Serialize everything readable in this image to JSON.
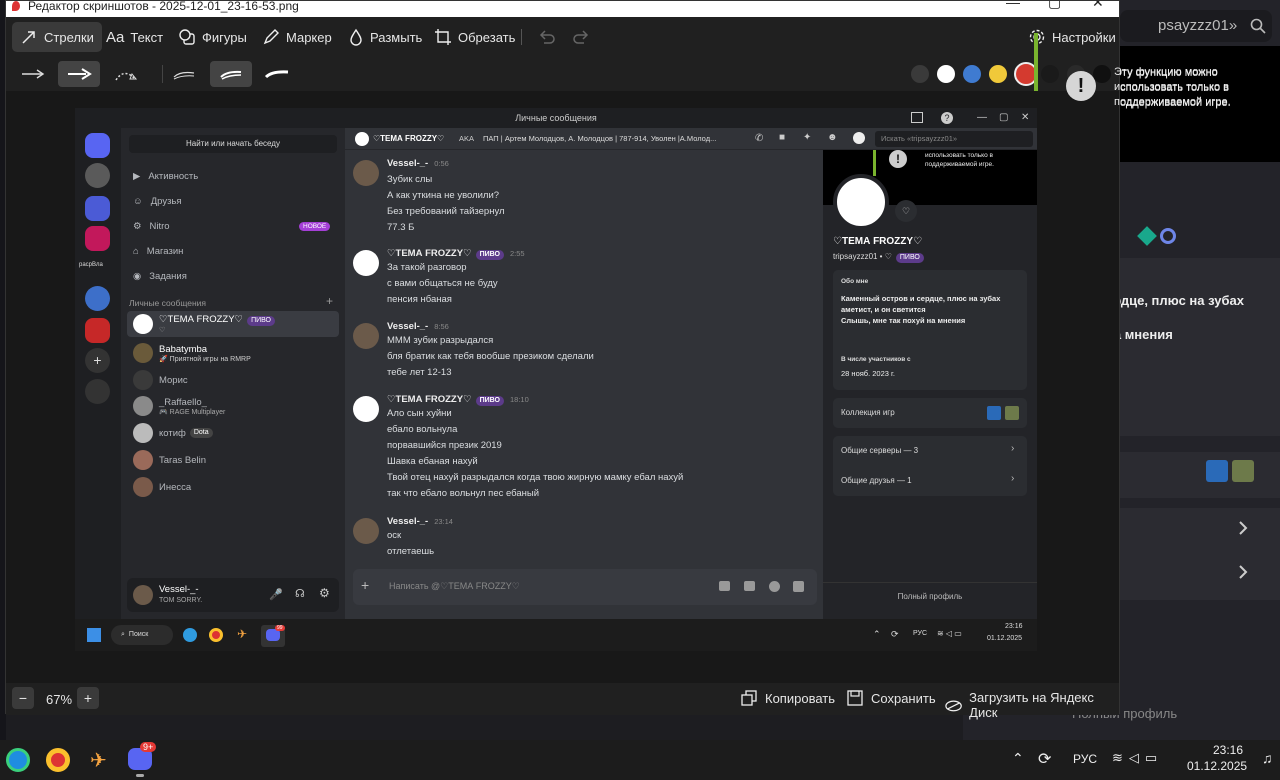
{
  "bg": {
    "search_text": "psayzzz01»",
    "feature_note": "Эту функцию можно использовать только в поддерживаемой игре.",
    "about_l1": "ердце, плюс на зубах",
    "about_l2": "я",
    "about_l3": "на мнения",
    "full_profile": "Полный профиль"
  },
  "editor": {
    "title": "Редактор скриншотов - 2025-12-01_23-16-53.png",
    "tools": {
      "arrows": "Стрелки",
      "text": "Текст",
      "figures": "Фигуры",
      "marker": "Маркер",
      "blur": "Размыть",
      "crop": "Обрезать",
      "settings": "Настройки"
    },
    "colors": [
      "#3a3a3a",
      "#ffffff",
      "#3f7bd1",
      "#f0c93a",
      "#d43a2f",
      "#1a1a1a",
      "#2a2a2a",
      "#101010"
    ],
    "zoom": "67%",
    "copy": "Копировать",
    "save": "Сохранить",
    "upload": "Загрузить на Яндекс Диск",
    "note": "Эту функцию можно использовать только в поддерживаемой игре."
  },
  "discord": {
    "window_title": "Личные сообщения",
    "find_button": "Найти или начать беседу",
    "nav": [
      {
        "label": "Активность"
      },
      {
        "label": "Друзья"
      },
      {
        "label": "Nitro",
        "badge": "НОВОЕ"
      },
      {
        "label": "Магазин"
      },
      {
        "label": "Задания"
      }
    ],
    "dm_header": "Личные сообщения",
    "server_label": "pacpВла",
    "dms": [
      {
        "name": "♡ТЕМА FROZZY♡",
        "badge": "ПИВО",
        "sub": "♡"
      },
      {
        "name": "Babatymba",
        "sub": "🚀 Приятной игры на RMRP"
      },
      {
        "name": "Морис",
        "sub": ""
      },
      {
        "name": "_Raffaello_",
        "sub": "🎮 RAGE Multiplayer"
      },
      {
        "name": "котиф",
        "badge2": "Dota",
        "sub": ""
      },
      {
        "name": "Taras Belin",
        "sub": ""
      },
      {
        "name": "Инесса",
        "sub": ""
      }
    ],
    "me": {
      "name": "Vessel-_-",
      "status": "TOM SORRY."
    },
    "chat_header": {
      "name": "♡ТЕМА FROZZY♡",
      "aka_label": "AKA",
      "aka": "ПАП | Артем Молодцов, А. Молодцов | 787-914, Уволен |А.Молод...",
      "search": "Искать «tripsayzzz01»"
    },
    "messages": [
      {
        "author": "Vessel-_-",
        "time": "0:56",
        "lines": [
          "Зубик слы",
          "А как уткина не уволили?",
          "Без требований тайзернул",
          "77.3 Б"
        ]
      },
      {
        "author": "♡ТЕМА FROZZY♡",
        "badge": "ПИВО",
        "time": "2:55",
        "lines": [
          "За такой разговор",
          "с вами общаться не буду",
          "пенсия нбаная"
        ]
      },
      {
        "author": "Vessel-_-",
        "time": "8:56",
        "lines": [
          "МММ зубик разрыдался",
          "бля братик как тебя вообше презиком сделали",
          "тебе лет 12-13"
        ]
      },
      {
        "author": "♡ТЕМА FROZZY♡",
        "badge": "ПИВО",
        "time": "18:10",
        "lines": [
          "Ало сын хуйни",
          "ебало вольнула",
          "порвавшийся презик 2019",
          "Шавка ебаная нахуй",
          "Твой отец нахуй разрыдался когда твою жирную мамку ебал нахуй",
          "так что ебало вольнул пес ебаный"
        ]
      },
      {
        "author": "Vessel-_-",
        "time": "23:14",
        "lines": [
          "оск",
          "отлетаешь"
        ]
      }
    ],
    "input_placeholder": "Написать @♡ТЕМА FROZZY♡",
    "profile": {
      "note": "Эту функцию можно использовать только в поддерживаемой игре.",
      "name": "♡ТЕМА FROZZY♡",
      "handle": "tripsayzzz01 • ♡",
      "badge": "ПИВО",
      "about_title": "Обо мне",
      "about_lines": [
        "Каменный остров и сердце, плюс на зубах",
        "аметист, и он светится",
        "Слышь, мне так похуй на мнения"
      ],
      "member_title": "В числе участников с",
      "member_date": "28 нояб. 2023 г.",
      "games": "Коллекция игр",
      "servers": "Общие серверы — 3",
      "friends": "Общие друзья — 1",
      "full": "Полный профиль"
    },
    "taskbar": {
      "search": "Поиск",
      "lang": "РУС",
      "time": "23:16",
      "date": "01.12.2025",
      "badge": "99"
    }
  },
  "taskbar": {
    "lang": "РУС",
    "time": "23:16",
    "date": "01.12.2025",
    "badge": "9+"
  }
}
